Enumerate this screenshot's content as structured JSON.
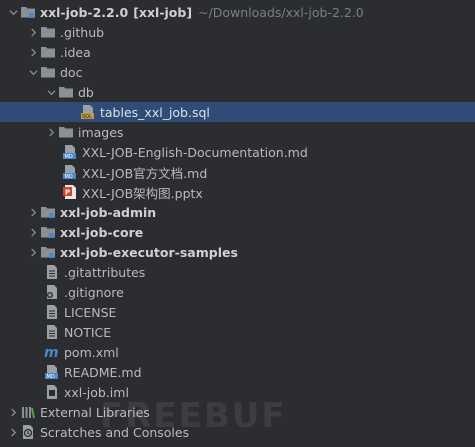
{
  "root": {
    "name": "xxl-job-2.2.0",
    "module": "[xxl-job]",
    "path": "~/Downloads/xxl-job-2.2.0"
  },
  "items": {
    "github": ".github",
    "idea": ".idea",
    "doc": "doc",
    "db": "db",
    "sql": "tables_xxl_job.sql",
    "images": "images",
    "md_en": "XXL-JOB-English-Documentation.md",
    "md_cn": "XXL-JOB官方文档.md",
    "pptx": "XXL-JOB架构图.pptx",
    "admin": "xxl-job-admin",
    "core": "xxl-job-core",
    "samples": "xxl-job-executor-samples",
    "gitattributes": ".gitattributes",
    "gitignore": ".gitignore",
    "license": "LICENSE",
    "notice": "NOTICE",
    "pom": "pom.xml",
    "readme": "README.md",
    "iml": "xxl-job.iml",
    "ext_libs": "External Libraries",
    "scratches": "Scratches and Consoles"
  },
  "watermark": "FREEBUF",
  "colors": {
    "background": "#2b2d30",
    "selection": "#2f4b77",
    "folder": "#8c8f94",
    "module_dot": "#4a88c7"
  }
}
